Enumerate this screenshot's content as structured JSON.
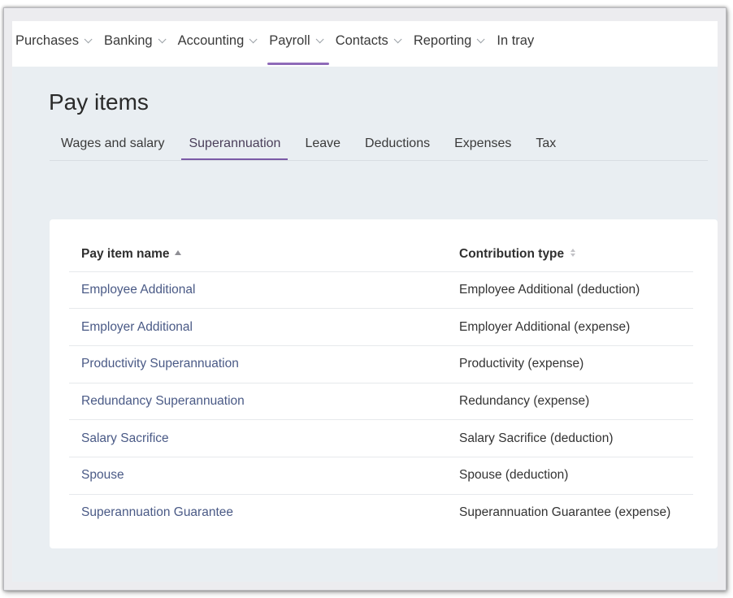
{
  "nav": {
    "items": [
      {
        "label": "Purchases",
        "has_dropdown": true,
        "active": false
      },
      {
        "label": "Banking",
        "has_dropdown": true,
        "active": false
      },
      {
        "label": "Accounting",
        "has_dropdown": true,
        "active": false
      },
      {
        "label": "Payroll",
        "has_dropdown": true,
        "active": true
      },
      {
        "label": "Contacts",
        "has_dropdown": true,
        "active": false
      },
      {
        "label": "Reporting",
        "has_dropdown": true,
        "active": false
      },
      {
        "label": "In tray",
        "has_dropdown": false,
        "active": false
      }
    ]
  },
  "page": {
    "title": "Pay items"
  },
  "tabs": [
    {
      "label": "Wages and salary",
      "active": false
    },
    {
      "label": "Superannuation",
      "active": true
    },
    {
      "label": "Leave",
      "active": false
    },
    {
      "label": "Deductions",
      "active": false
    },
    {
      "label": "Expenses",
      "active": false
    },
    {
      "label": "Tax",
      "active": false
    }
  ],
  "table": {
    "columns": [
      {
        "label": "Pay item name",
        "sort": "ascending",
        "icon": "sort-ascending-icon"
      },
      {
        "label": "Contribution type",
        "sort": "none",
        "icon": "sort-icon"
      }
    ],
    "rows": [
      {
        "name": "Employee Additional",
        "type": "Employee Additional (deduction)"
      },
      {
        "name": "Employer Additional",
        "type": "Employer Additional (expense)"
      },
      {
        "name": "Productivity Superannuation",
        "type": "Productivity (expense)"
      },
      {
        "name": "Redundancy Superannuation",
        "type": "Redundancy (expense)"
      },
      {
        "name": "Salary Sacrifice",
        "type": "Salary Sacrifice (deduction)"
      },
      {
        "name": "Spouse",
        "type": "Spouse (deduction)"
      },
      {
        "name": "Superannuation Guarantee",
        "type": "Superannuation Guarantee (expense)"
      }
    ]
  },
  "colors": {
    "accent": "#8e6ab8",
    "link": "#4a5a86",
    "page_bg": "#e9eef2",
    "card_bg": "#ffffff"
  }
}
